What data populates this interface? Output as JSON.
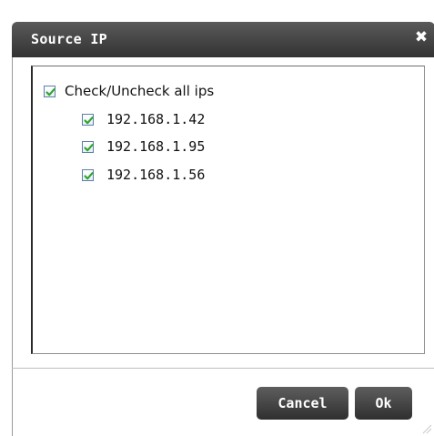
{
  "dialog": {
    "title": "Source IP",
    "close_icon": "close-icon",
    "check_all": {
      "label": "Check/Uncheck all ips",
      "checked": true
    },
    "ips": [
      {
        "label": "192.168.1.42",
        "checked": true
      },
      {
        "label": "192.168.1.95",
        "checked": true
      },
      {
        "label": "192.168.1.56",
        "checked": true
      }
    ],
    "buttons": {
      "cancel": "Cancel",
      "ok": "Ok"
    }
  },
  "colors": {
    "titlebar": "#444444",
    "button": "#444444",
    "check": "#2ea52e"
  }
}
